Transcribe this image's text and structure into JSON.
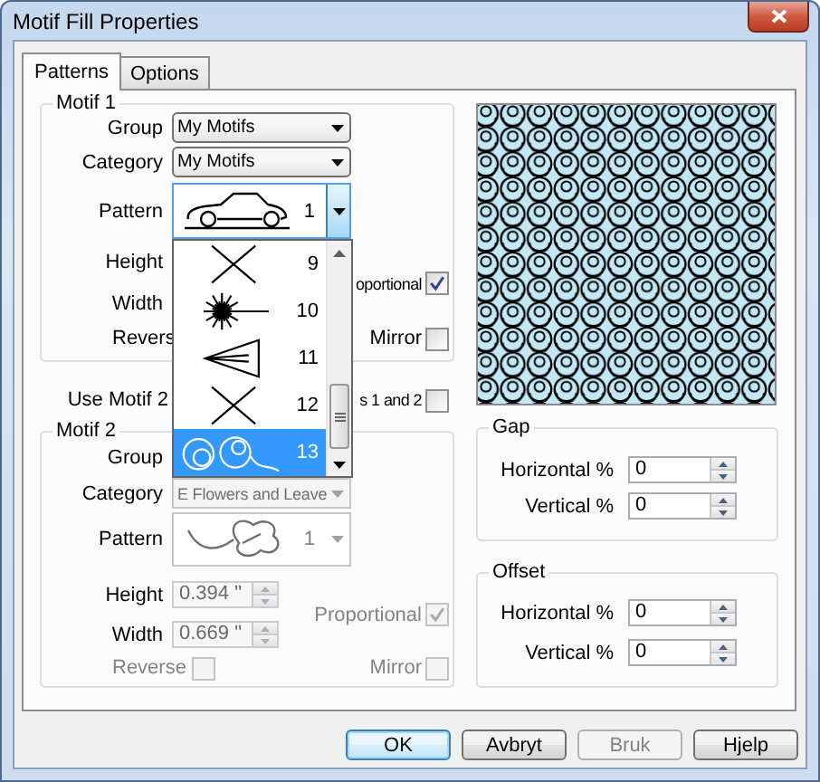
{
  "window": {
    "title": "Motif Fill Properties"
  },
  "tabs": [
    {
      "label": "Patterns",
      "selected": true
    },
    {
      "label": "Options",
      "selected": false
    }
  ],
  "motif_1": {
    "title": "Motif 1",
    "group": {
      "label": "Group",
      "value": "My Motifs"
    },
    "category": {
      "label": "Category",
      "value": "My Motifs"
    },
    "pattern": {
      "label": "Pattern",
      "number": "1",
      "kind": "car",
      "expanded": true,
      "options": [
        {
          "number": "9",
          "kind": "cross",
          "selected": false
        },
        {
          "number": "10",
          "kind": "burst",
          "selected": false
        },
        {
          "number": "11",
          "kind": "fan",
          "selected": false
        },
        {
          "number": "12",
          "kind": "cross",
          "selected": false
        },
        {
          "number": "13",
          "kind": "loops",
          "selected": true
        }
      ]
    },
    "height": {
      "label": "Height"
    },
    "width": {
      "label": "Width"
    },
    "proportional": {
      "label": "oportional",
      "checked": true
    },
    "reverse": {
      "label": "Revers"
    },
    "mirror": {
      "label": "Mirror",
      "checked": false
    }
  },
  "use_motif_2": {
    "label": "Use Motif 2",
    "label_end": "s 1 and 2",
    "checked": false
  },
  "motif_2": {
    "title": "Motif 2",
    "group": {
      "label": "Group"
    },
    "category": {
      "label": "Category",
      "value": "E Flowers and Leave",
      "disabled": true
    },
    "pattern": {
      "label": "Pattern",
      "number": "1",
      "kind": "leaf",
      "disabled": true,
      "expanded": false
    },
    "height": {
      "label": "Height",
      "value": "0.394 \"",
      "disabled": true
    },
    "width": {
      "label": "Width",
      "value": "0.669 \"",
      "disabled": true
    },
    "proportional": {
      "label": "Proportional",
      "checked": true,
      "disabled": true
    },
    "reverse": {
      "label": "Reverse",
      "checked": false,
      "disabled": true
    },
    "mirror": {
      "label": "Mirror",
      "checked": false,
      "disabled": true
    }
  },
  "gap": {
    "title": "Gap",
    "fields": [
      {
        "label": "Horizontal %",
        "value": "0"
      },
      {
        "label": "Vertical %",
        "value": "0"
      }
    ]
  },
  "offset": {
    "title": "Offset",
    "fields": [
      {
        "label": "Horizontal %",
        "value": "0"
      },
      {
        "label": "Vertical %",
        "value": "0"
      }
    ]
  },
  "buttons": [
    {
      "label": "OK",
      "default": true,
      "disabled": false
    },
    {
      "label": "Avbryt",
      "default": false,
      "disabled": false
    },
    {
      "label": "Bruk",
      "default": false,
      "disabled": true
    },
    {
      "label": "Hjelp",
      "default": false,
      "disabled": false
    }
  ]
}
